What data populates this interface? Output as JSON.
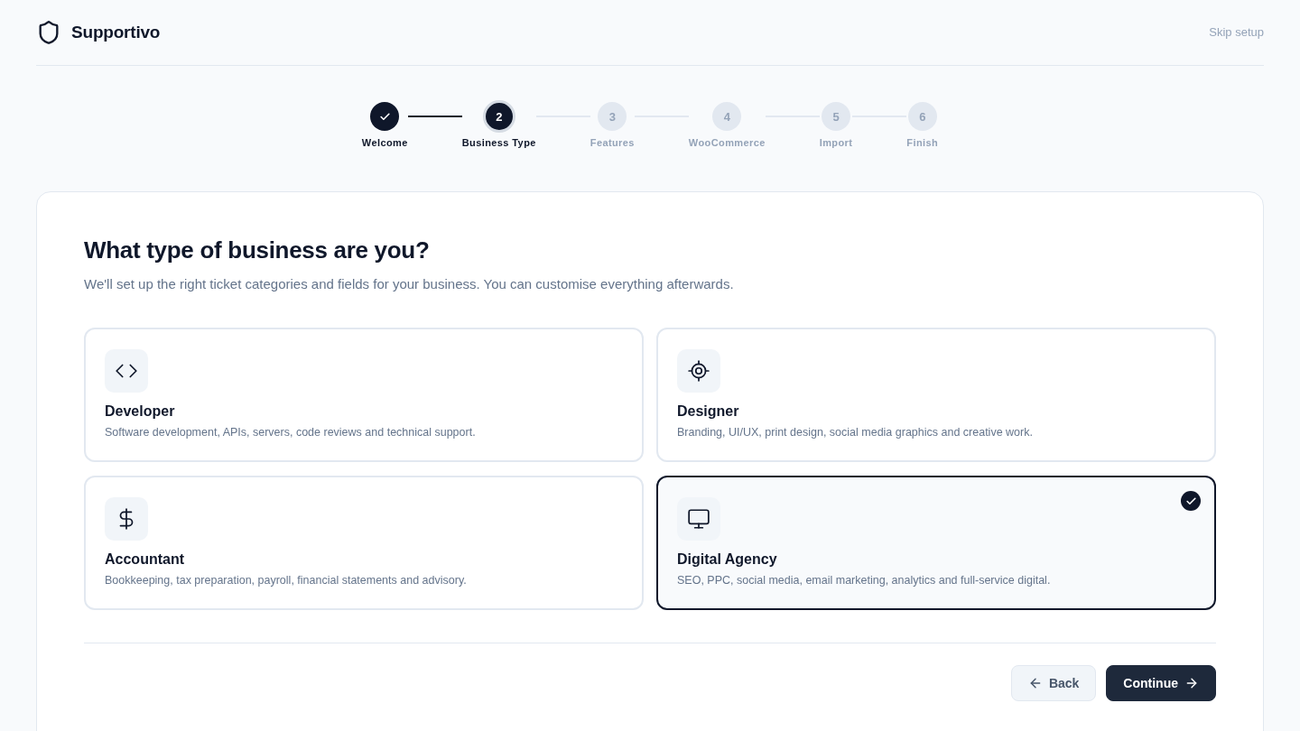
{
  "brand": {
    "name": "Supportivo"
  },
  "header": {
    "skip_link": "Skip setup"
  },
  "steps": [
    {
      "kind": "done",
      "label": "Welcome"
    },
    {
      "kind": "current",
      "number": "2",
      "label": "Business Type"
    },
    {
      "kind": "upcoming",
      "number": "3",
      "label": "Features"
    },
    {
      "kind": "upcoming",
      "number": "4",
      "label": "WooCommerce"
    },
    {
      "kind": "upcoming",
      "number": "5",
      "label": "Import"
    },
    {
      "kind": "upcoming",
      "number": "6",
      "label": "Finish"
    }
  ],
  "question": {
    "title": "What type of business are you?",
    "subtitle": "We'll set up the right ticket categories and fields for your business. You can customise everything afterwards."
  },
  "options": [
    {
      "title": "Developer",
      "description": "Software development, APIs, servers, code reviews and technical support.",
      "selected": false
    },
    {
      "title": "Designer",
      "description": "Branding, UI/UX, print design, social media graphics and creative work.",
      "selected": false
    },
    {
      "title": "Accountant",
      "description": "Bookkeeping, tax preparation, payroll, financial statements and advisory.",
      "selected": false
    },
    {
      "title": "Digital Agency",
      "description": "SEO, PPC, social media, email marketing, analytics and full-service digital.",
      "selected": true
    }
  ],
  "actions": {
    "back": "Back",
    "continue": "Continue"
  }
}
